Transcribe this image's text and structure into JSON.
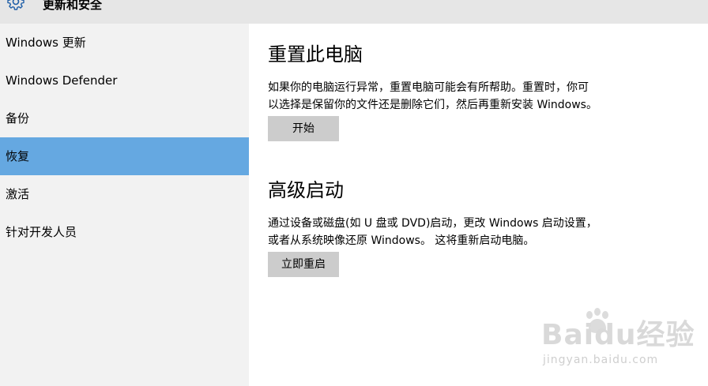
{
  "header": {
    "title": "更新和安全",
    "icon": "gear-icon"
  },
  "sidebar": {
    "items": [
      {
        "label": "Windows 更新",
        "selected": false
      },
      {
        "label": "Windows Defender",
        "selected": false
      },
      {
        "label": "备份",
        "selected": false
      },
      {
        "label": "恢复",
        "selected": true
      },
      {
        "label": "激活",
        "selected": false
      },
      {
        "label": "针对开发人员",
        "selected": false
      }
    ],
    "selected_color": "#65a8e1"
  },
  "main": {
    "reset": {
      "heading": "重置此电脑",
      "line1": "如果你的电脑运行异常，重置电脑可能会有所帮助。重置时，你可",
      "line2": "以选择是保留你的文件还是删除它们，然后再重新安装 Windows。",
      "button": "开始"
    },
    "advanced": {
      "heading": "高级启动",
      "line1": "通过设备或磁盘(如 U 盘或 DVD)启动，更改 Windows 启动设置，",
      "line2": "或者从系统映像还原 Windows。 这将重新启动电脑。",
      "button": "立即重启"
    }
  },
  "watermark": {
    "main": "Baidu经验",
    "sub": "jingyan.baidu.com"
  }
}
